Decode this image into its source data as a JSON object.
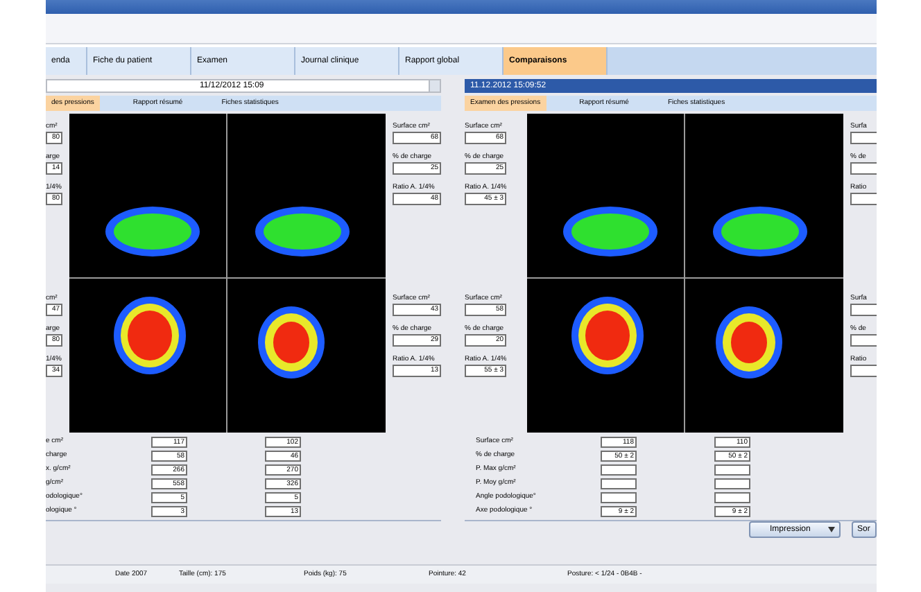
{
  "tabs": [
    {
      "label": "enda",
      "selected": false
    },
    {
      "label": "Fiche du patient",
      "selected": false
    },
    {
      "label": "Examen",
      "selected": false
    },
    {
      "label": "Journal clinique",
      "selected": false
    },
    {
      "label": "Rapport global",
      "selected": false
    },
    {
      "label": "Comparaisons",
      "selected": true
    }
  ],
  "panels": [
    {
      "header": "11/12/2012 15:09",
      "kind": "dropdown",
      "subtabs": [
        {
          "label": "des pressions",
          "selected": true
        },
        {
          "label": "Rapport résumé",
          "selected": false
        },
        {
          "label": "Fiches statistiques",
          "selected": false
        }
      ],
      "left_fields": [
        {
          "label": "cm²",
          "value": "80"
        },
        {
          "label": "arge",
          "value": "14"
        },
        {
          "label": "1/4%",
          "value": "80"
        },
        {
          "label": "cm²",
          "value": "47"
        },
        {
          "label": "arge",
          "value": "80"
        },
        {
          "label": "1/4%",
          "value": "34"
        }
      ],
      "right_fields": [
        {
          "label": "Surface cm²",
          "value": "68"
        },
        {
          "label": "% de charge",
          "value": "25"
        },
        {
          "label": "Ratio A. 1/4%",
          "value": "48"
        },
        {
          "label": "Surface cm²",
          "value": "43"
        },
        {
          "label": "% de charge",
          "value": "29"
        },
        {
          "label": "Ratio A. 1/4%",
          "value": "13"
        }
      ],
      "table": [
        {
          "label": "e cm²",
          "cells": [
            {
              "value": "117"
            },
            {
              "value": "102"
            }
          ]
        },
        {
          "label": "charge",
          "cells": [
            {
              "value": "58"
            },
            {
              "value": "46"
            }
          ]
        },
        {
          "label": "x. g/cm²",
          "cells": [
            {
              "value": "266"
            },
            {
              "value": "270"
            }
          ]
        },
        {
          "label": "g/cm²",
          "cells": [
            {
              "value": "558"
            },
            {
              "value": "326"
            }
          ]
        },
        {
          "label": "odologique°",
          "cells": [
            {
              "value": "5"
            },
            {
              "value": "5"
            }
          ]
        },
        {
          "label": "ologique °",
          "cells": [
            {
              "value": "3"
            },
            {
              "value": "13"
            }
          ]
        }
      ]
    },
    {
      "header": "11.12.2012 15:09:52",
      "kind": "bar",
      "subtabs": [
        {
          "label": "Examen des pressions",
          "selected": true
        },
        {
          "label": "Rapport résumé",
          "selected": false
        },
        {
          "label": "Fiches statistiques",
          "selected": false
        }
      ],
      "left_fields": [
        {
          "label": "Surface cm²",
          "value": "68"
        },
        {
          "label": "% de charge",
          "value": "25"
        },
        {
          "label": "Ratio A. 1/4%",
          "value": "45 ± 3"
        },
        {
          "label": "Surface cm²",
          "value": "58"
        },
        {
          "label": "% de charge",
          "value": "20"
        },
        {
          "label": "Ratio A. 1/4%",
          "value": "55 ± 3"
        }
      ],
      "right_fields": [
        {
          "label": "Surfa"
        },
        {
          "label": "% de"
        },
        {
          "label": "Ratio"
        },
        {
          "label": "Surfa"
        },
        {
          "label": "% de"
        },
        {
          "label": "Ratio"
        }
      ],
      "table": [
        {
          "label": "Surface cm²",
          "cells": [
            {
              "value": "118"
            },
            {
              "value": "110"
            }
          ]
        },
        {
          "label": "% de charge",
          "cells": [
            {
              "value": "50 ± 2"
            },
            {
              "value": "50 ± 2"
            }
          ]
        },
        {
          "label": "P. Max g/cm²",
          "cells": [
            {},
            {}
          ]
        },
        {
          "label": "P. Moy g/cm²",
          "cells": [
            {},
            {}
          ]
        },
        {
          "label": "Angle podologique°",
          "cells": [
            {},
            {}
          ]
        },
        {
          "label": "Axe podologique °",
          "cells": [
            {
              "value": "9 ± 2"
            },
            {
              "value": "9 ± 2"
            }
          ]
        }
      ]
    }
  ],
  "buttons": [
    {
      "label": "Impression",
      "kind": "dropdown"
    },
    {
      "label": "Sor",
      "kind": "plain"
    }
  ],
  "status_bar": [
    "Date 2007",
    "Taille (cm): 175",
    "Poids (kg): 75",
    "Pointure: 42",
    "Posture: < 1/24 - 0B4B -"
  ]
}
